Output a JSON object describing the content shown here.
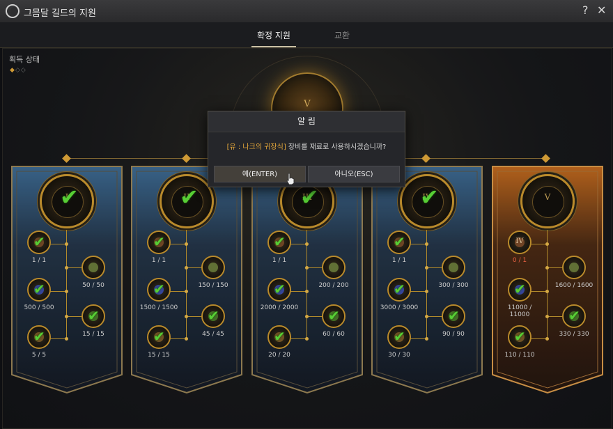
{
  "window": {
    "title": "그믐달 길드의 지원",
    "help_icon": "?",
    "close_icon": "✕"
  },
  "tabs": [
    {
      "label": "확정 지원",
      "active": true
    },
    {
      "label": "교환",
      "active": false
    }
  ],
  "status": {
    "label": "획득 상태",
    "diamonds": "◆◇◇"
  },
  "center": {
    "numeral": "V"
  },
  "banners": [
    {
      "numeral": "I",
      "theme": "blue",
      "nodes": [
        {
          "count": "1 / 1",
          "complete": true
        },
        {
          "count": "500 / 500",
          "complete": true
        },
        {
          "count": "5 / 5",
          "complete": true
        },
        {
          "count": "50 / 50",
          "complete": false
        },
        {
          "count": "15 / 15",
          "complete": true
        }
      ]
    },
    {
      "numeral": "II",
      "theme": "blue",
      "nodes": [
        {
          "count": "1 / 1",
          "complete": true
        },
        {
          "count": "1500 / 1500",
          "complete": true
        },
        {
          "count": "15 / 15",
          "complete": true
        },
        {
          "count": "150 / 150",
          "complete": false
        },
        {
          "count": "45 / 45",
          "complete": true
        }
      ]
    },
    {
      "numeral": "III",
      "theme": "blue",
      "nodes": [
        {
          "count": "1 / 1",
          "complete": true
        },
        {
          "count": "2000 / 2000",
          "complete": true
        },
        {
          "count": "20 / 20",
          "complete": true
        },
        {
          "count": "200 / 200",
          "complete": false
        },
        {
          "count": "60 / 60",
          "complete": true
        }
      ]
    },
    {
      "numeral": "IV",
      "theme": "blue",
      "nodes": [
        {
          "count": "1 / 1",
          "complete": true
        },
        {
          "count": "3000 / 3000",
          "complete": true
        },
        {
          "count": "30 / 30",
          "complete": true
        },
        {
          "count": "300 / 300",
          "complete": false
        },
        {
          "count": "90 / 90",
          "complete": true
        }
      ]
    },
    {
      "numeral": "V",
      "theme": "orange",
      "nodes": [
        {
          "count": "0 / 1",
          "complete": false,
          "numeral": "IV"
        },
        {
          "count": "11000 / 11000",
          "complete": true
        },
        {
          "count": "110 / 110",
          "complete": true
        },
        {
          "count": "1600 / 1600",
          "complete": false
        },
        {
          "count": "330 / 330",
          "complete": true
        }
      ]
    }
  ],
  "dialog": {
    "title": "알 림",
    "message_highlight": "[유 : 나크의 귀장식]",
    "message_rest": " 장비를 재료로 사용하시겠습니까?",
    "yes_label": "예(ENTER)",
    "no_label": "아니오(ESC)"
  },
  "colors": {
    "accent_gold": "#c9962f",
    "check_green": "#5fe03a",
    "highlight_orange": "#e6a83a"
  }
}
